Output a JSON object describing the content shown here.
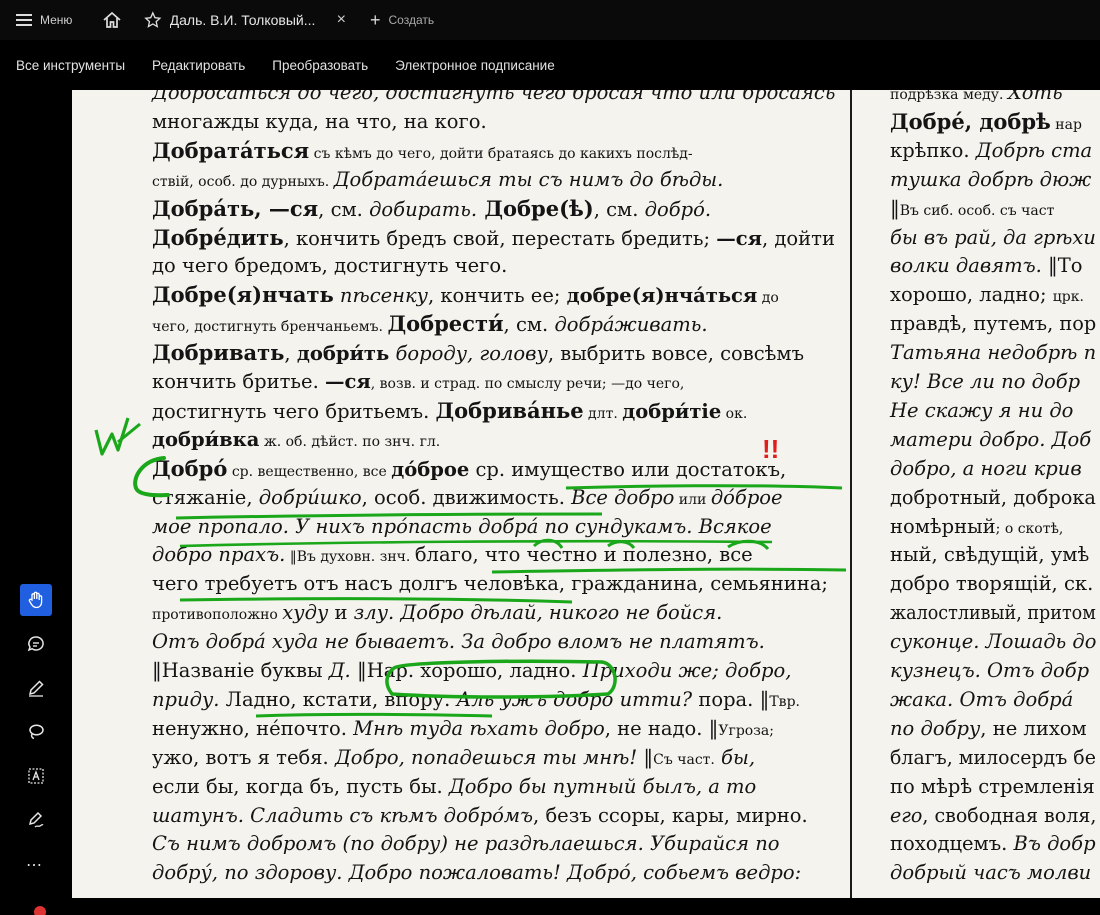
{
  "tabbar": {
    "menu_label": "Меню",
    "doc_tab_title": "Даль. В.И. Толковый...",
    "close_glyph": "×",
    "create_label": "Создать",
    "plus_glyph": "+"
  },
  "toolbar": {
    "items": [
      "Все инструменты",
      "Редактировать",
      "Преобразовать",
      "Электронное подписание"
    ]
  },
  "rail": {
    "more_glyph": "⋯"
  },
  "annotations": {
    "exclaim": "!!",
    "margin_mark": "Ш"
  },
  "left_column": [
    {
      "runs": [
        {
          "t": "Добросаться до чего, достигнуть чего бросая что или бросаясь",
          "c": "ital"
        }
      ]
    },
    {
      "runs": [
        {
          "t": "многажды куда, на что, на кого.",
          "c": ""
        }
      ]
    },
    {
      "runs": [
        {
          "t": "Добрата́ться",
          "c": "head"
        },
        {
          "t": " съ кѣмъ до чего, дойти братаясь до какихъ послѣд-",
          "c": "small"
        }
      ]
    },
    {
      "runs": [
        {
          "t": "ствій, особ. до дурныхъ. ",
          "c": "small"
        },
        {
          "t": "Добрата́ешься ты съ нимъ до бѣды.",
          "c": "ital"
        }
      ]
    },
    {
      "runs": [
        {
          "t": "Добра́ть, —ся",
          "c": "head"
        },
        {
          "t": ", см. ",
          "c": ""
        },
        {
          "t": "добирать.",
          "c": "ital"
        },
        {
          "t": " Добре(ѣ)",
          "c": "head"
        },
        {
          "t": ", см. ",
          "c": ""
        },
        {
          "t": "добро́.",
          "c": "ital"
        }
      ]
    },
    {
      "runs": [
        {
          "t": "Добре́дить",
          "c": "head"
        },
        {
          "t": ", кончить бредъ свой, перестать бредить; ",
          "c": ""
        },
        {
          "t": "—ся",
          "c": "bold"
        },
        {
          "t": ", дойти",
          "c": ""
        }
      ]
    },
    {
      "runs": [
        {
          "t": "до чего бредомъ, достигнуть чего.",
          "c": ""
        }
      ]
    },
    {
      "runs": [
        {
          "t": "Добре(я)нчать",
          "c": "head"
        },
        {
          "t": " пѣсенку",
          "c": "ital"
        },
        {
          "t": ", кончить ее; ",
          "c": ""
        },
        {
          "t": "добре(я)нча́ться",
          "c": "bold"
        },
        {
          "t": " до",
          "c": "small"
        }
      ]
    },
    {
      "runs": [
        {
          "t": "чего, достигнуть бренчаньемъ. ",
          "c": "small"
        },
        {
          "t": "Добрести́",
          "c": "head"
        },
        {
          "t": ", см. ",
          "c": ""
        },
        {
          "t": "добра́живать.",
          "c": "ital"
        }
      ]
    },
    {
      "runs": [
        {
          "t": "Добривать",
          "c": "head"
        },
        {
          "t": ", ",
          "c": ""
        },
        {
          "t": "добри́ть",
          "c": "bold"
        },
        {
          "t": " бороду, голову",
          "c": "ital"
        },
        {
          "t": ", выбрить вовсе, совсѣмъ",
          "c": ""
        }
      ]
    },
    {
      "runs": [
        {
          "t": "кончить бритье. ",
          "c": ""
        },
        {
          "t": "—ся",
          "c": "bold"
        },
        {
          "t": ", возв. и страд. по смыслу речи; —до чего,",
          "c": "small"
        }
      ]
    },
    {
      "runs": [
        {
          "t": "достигнуть чего бритьемъ. ",
          "c": ""
        },
        {
          "t": "Добрива́нье",
          "c": "head"
        },
        {
          "t": " длт. ",
          "c": "small"
        },
        {
          "t": "добри́тіе",
          "c": "bold"
        },
        {
          "t": " ок.",
          "c": "small"
        }
      ]
    },
    {
      "runs": [
        {
          "t": "добри́вка",
          "c": "bold"
        },
        {
          "t": " ж. об. дѣйст. по знч. гл.",
          "c": "small"
        }
      ]
    },
    {
      "runs": [
        {
          "t": "Добро́",
          "c": "head"
        },
        {
          "t": " ср. вещественно, все ",
          "c": "small"
        },
        {
          "t": "до́брое",
          "c": "bold"
        },
        {
          "t": " ср. имущество или достатокъ,",
          "c": ""
        }
      ]
    },
    {
      "runs": [
        {
          "t": "стяжаніе, ",
          "c": ""
        },
        {
          "t": "добри́шко",
          "c": "ital"
        },
        {
          "t": ", особ. движимость. ",
          "c": ""
        },
        {
          "t": "Все добро",
          "c": "ital"
        },
        {
          "t": " или ",
          "c": "small"
        },
        {
          "t": "до́брое",
          "c": "ital"
        }
      ]
    },
    {
      "runs": [
        {
          "t": "мое пропало. У нихъ про́пасть добра́ по сундукамъ. Всякое",
          "c": "ital"
        }
      ]
    },
    {
      "runs": [
        {
          "t": "добро прахъ.",
          "c": "ital"
        },
        {
          "t": " ‖Въ духовн. знч. ",
          "c": "small"
        },
        {
          "t": "благо, что честно и полезно, все",
          "c": ""
        }
      ]
    },
    {
      "runs": [
        {
          "t": "чего требуетъ отъ насъ долгъ человѣка, гражданина, семьянина;",
          "c": ""
        }
      ]
    },
    {
      "runs": [
        {
          "t": "противоположно ",
          "c": "small"
        },
        {
          "t": "худу",
          "c": "ital"
        },
        {
          "t": " и ",
          "c": ""
        },
        {
          "t": "злу. Добро дѣлай, никого не бойся.",
          "c": "ital"
        }
      ]
    },
    {
      "runs": [
        {
          "t": "Отъ добра́ худа не бываетъ. За добро вломъ не платятъ.",
          "c": "ital"
        }
      ]
    },
    {
      "runs": [
        {
          "t": "‖Названіе буквы ",
          "c": ""
        },
        {
          "t": "Д.",
          "c": "ital"
        },
        {
          "t": " ‖Нар. хорошо, ладно. ",
          "c": ""
        },
        {
          "t": "Приходи же; добро,",
          "c": "ital"
        }
      ]
    },
    {
      "runs": [
        {
          "t": "приду. ",
          "c": "ital"
        },
        {
          "t": "Ладно, кстати, впору. ",
          "c": ""
        },
        {
          "t": "Аль ужъ добро итти?",
          "c": "ital"
        },
        {
          "t": " пора. ‖",
          "c": ""
        },
        {
          "t": "Твр.",
          "c": "small"
        }
      ]
    },
    {
      "runs": [
        {
          "t": "ненужно, не́почто. ",
          "c": ""
        },
        {
          "t": "Мнѣ туда ѣхать добро",
          "c": "ital"
        },
        {
          "t": ", не надо. ‖",
          "c": ""
        },
        {
          "t": "Угроза;",
          "c": "small"
        }
      ]
    },
    {
      "runs": [
        {
          "t": "ужо, вотъ я тебя. ",
          "c": ""
        },
        {
          "t": "Добро, попадешься ты мнѣ!",
          "c": "ital"
        },
        {
          "t": " ‖",
          "c": ""
        },
        {
          "t": "Съ част.",
          "c": "small"
        },
        {
          "t": " бы,",
          "c": "ital"
        }
      ]
    },
    {
      "runs": [
        {
          "t": "если бы, когда бъ, пусть бы. ",
          "c": ""
        },
        {
          "t": "Добро бы путный былъ, а то",
          "c": "ital"
        }
      ]
    },
    {
      "runs": [
        {
          "t": "шатунъ. Сладить съ кѣмъ добро́мъ",
          "c": "ital"
        },
        {
          "t": ", безъ ссоры, кары, мирно.",
          "c": ""
        }
      ]
    },
    {
      "runs": [
        {
          "t": "Съ нимъ добромъ (по добру) не раздѣлаешься. Убирайся по",
          "c": "ital"
        }
      ]
    },
    {
      "runs": [
        {
          "t": "добру́, по здорову. Добро пожаловать! Добро́, собьемъ ведро:",
          "c": "ital"
        }
      ]
    }
  ],
  "right_column": [
    {
      "runs": [
        {
          "t": "подрѣзка меду. ",
          "c": "small"
        },
        {
          "t": "Хоть",
          "c": "ital"
        }
      ]
    },
    {
      "runs": [
        {
          "t": "Добре́, добрѣ",
          "c": "head"
        },
        {
          "t": " нар",
          "c": "small"
        }
      ]
    },
    {
      "runs": [
        {
          "t": "крѣпко. ",
          "c": ""
        },
        {
          "t": "Добрѣ ста",
          "c": "ital"
        }
      ]
    },
    {
      "runs": [
        {
          "t": "тушка добрѣ дюж",
          "c": "ital"
        }
      ]
    },
    {
      "runs": [
        {
          "t": "‖",
          "c": ""
        },
        {
          "t": "Въ сиб.",
          "c": "small"
        },
        {
          "t": " особ. съ част",
          "c": "small"
        }
      ]
    },
    {
      "runs": [
        {
          "t": "бы въ рай, да грѣхи",
          "c": "ital"
        }
      ]
    },
    {
      "runs": [
        {
          "t": "волки давятъ.",
          "c": "ital"
        },
        {
          "t": " ‖То",
          "c": ""
        }
      ]
    },
    {
      "runs": [
        {
          "t": "хорошо, ладно; ",
          "c": ""
        },
        {
          "t": "црк.",
          "c": "small"
        }
      ]
    },
    {
      "runs": [
        {
          "t": "правдѣ, путемъ, пор",
          "c": ""
        }
      ]
    },
    {
      "runs": [
        {
          "t": "Татьяна недобрѣ п",
          "c": "ital"
        }
      ]
    },
    {
      "runs": [
        {
          "t": "ку! Все ли по добр",
          "c": "ital"
        }
      ]
    },
    {
      "runs": [
        {
          "t": "Не скажу я ни до",
          "c": "ital"
        }
      ]
    },
    {
      "runs": [
        {
          "t": "матери добро. Доб",
          "c": "ital"
        }
      ]
    },
    {
      "runs": [
        {
          "t": "добро, а ноги крив",
          "c": "ital"
        }
      ]
    },
    {
      "runs": [
        {
          "t": "добротный, доброка",
          "c": ""
        }
      ]
    },
    {
      "runs": [
        {
          "t": "номѣрный",
          "c": ""
        },
        {
          "t": "; о скотѣ,",
          "c": "small"
        }
      ]
    },
    {
      "runs": [
        {
          "t": "ный, свѣдущій, умѣ",
          "c": ""
        }
      ]
    },
    {
      "runs": [
        {
          "t": "добро творящій, ск.",
          "c": ""
        }
      ]
    },
    {
      "runs": [
        {
          "t": "жалостливый, притом",
          "c": ""
        }
      ]
    },
    {
      "runs": [
        {
          "t": "суконце. Лошадь до",
          "c": "ital"
        }
      ]
    },
    {
      "runs": [
        {
          "t": "кузнецъ. Отъ добр",
          "c": "ital"
        }
      ]
    },
    {
      "runs": [
        {
          "t": "жака. Отъ добра́",
          "c": "ital"
        }
      ]
    },
    {
      "runs": [
        {
          "t": "по добру",
          "c": "ital"
        },
        {
          "t": ", не лихом",
          "c": ""
        }
      ]
    },
    {
      "runs": [
        {
          "t": "благъ, милосердъ бе",
          "c": ""
        }
      ]
    },
    {
      "runs": [
        {
          "t": "по мѣрѣ стремленія",
          "c": ""
        }
      ]
    },
    {
      "runs": [
        {
          "t": "его",
          "c": "ital"
        },
        {
          "t": ", свободная воля,",
          "c": ""
        }
      ]
    },
    {
      "runs": [
        {
          "t": "походцемъ. ",
          "c": ""
        },
        {
          "t": "Въ добр",
          "c": "ital"
        }
      ]
    },
    {
      "runs": [
        {
          "t": "добрый часъ молви",
          "c": "ital"
        }
      ]
    }
  ]
}
